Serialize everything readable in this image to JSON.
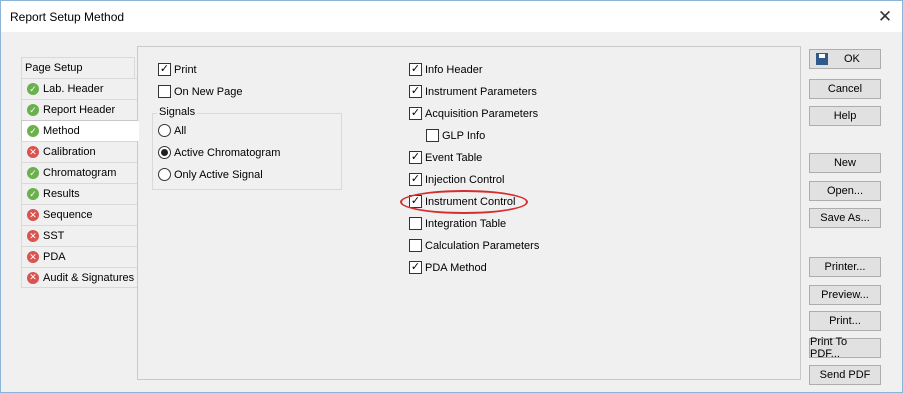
{
  "window": {
    "title": "Report Setup Method"
  },
  "tabs": [
    {
      "label": "Page Setup",
      "icon": "",
      "active": false
    },
    {
      "label": "Lab. Header",
      "icon": "check-circle-icon"
    },
    {
      "label": "Report Header",
      "icon": "check-circle-icon"
    },
    {
      "label": "Method",
      "icon": "check-circle-icon",
      "active": true
    },
    {
      "label": "Calibration",
      "icon": "error-circle-icon"
    },
    {
      "label": "Chromatogram",
      "icon": "check-circle-icon"
    },
    {
      "label": "Results",
      "icon": "check-circle-icon"
    },
    {
      "label": "Sequence",
      "icon": "error-circle-icon"
    },
    {
      "label": "SST",
      "icon": "error-circle-icon"
    },
    {
      "label": "PDA",
      "icon": "error-circle-icon"
    },
    {
      "label": "Audit & Signatures",
      "icon": "error-circle-icon"
    }
  ],
  "left_options": {
    "print": {
      "label": "Print",
      "checked": true
    },
    "on_new_page": {
      "label": "On New Page",
      "checked": false
    },
    "signals_group": "Signals",
    "signals": [
      {
        "label": "All",
        "selected": false
      },
      {
        "label": "Active Chromatogram",
        "selected": true
      },
      {
        "label": "Only Active Signal",
        "selected": false
      }
    ]
  },
  "right_options": [
    {
      "label": "Info Header",
      "checked": true
    },
    {
      "label": "Instrument Parameters",
      "checked": true
    },
    {
      "label": "Acquisition Parameters",
      "checked": true
    },
    {
      "label": "GLP Info",
      "checked": false
    },
    {
      "label": "Event Table",
      "checked": true
    },
    {
      "label": "Injection Control",
      "checked": true
    },
    {
      "label": "Instrument Control",
      "checked": true
    },
    {
      "label": "Integration Table",
      "checked": false
    },
    {
      "label": "Calculation Parameters",
      "checked": false
    },
    {
      "label": "PDA Method",
      "checked": true
    }
  ],
  "buttons": {
    "ok": "OK",
    "cancel": "Cancel",
    "help": "Help",
    "new": "New",
    "open": "Open...",
    "save_as": "Save As...",
    "printer": "Printer...",
    "preview": "Preview...",
    "print": "Print...",
    "print_to_pdf": "Print To PDF...",
    "send_pdf": "Send PDF"
  },
  "colors": {
    "ok_icon": "#6ab04c",
    "error_icon": "#d9534f",
    "highlight": "#d42f2f"
  }
}
